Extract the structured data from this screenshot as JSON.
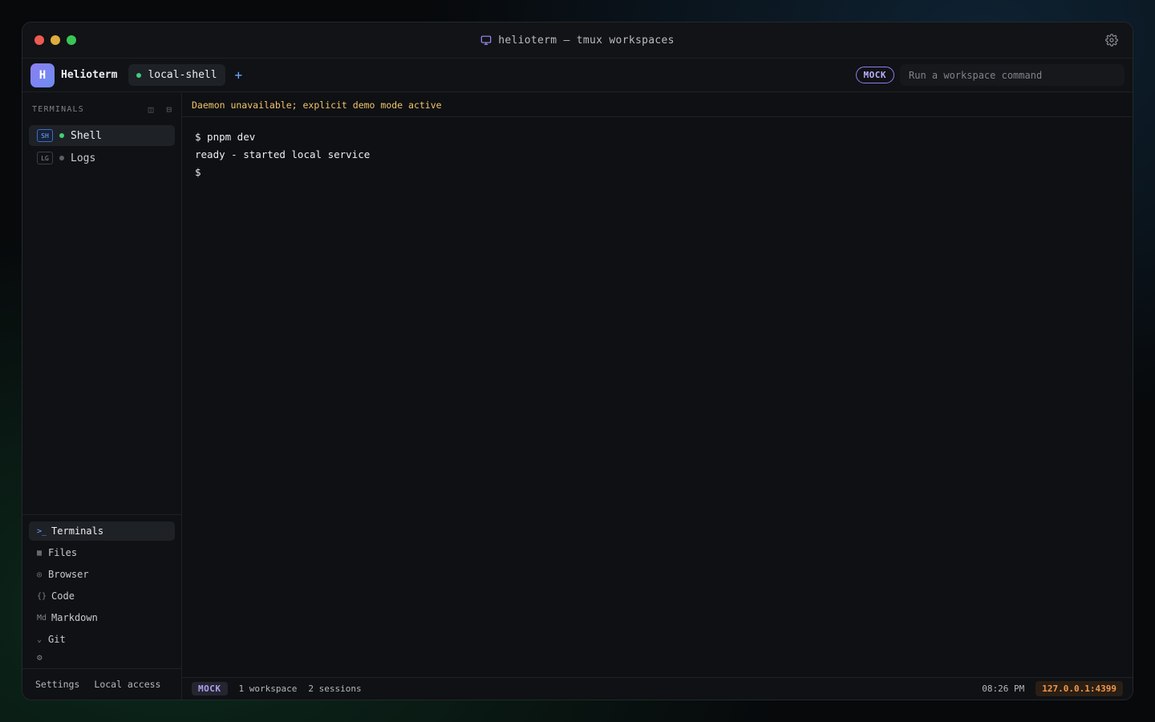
{
  "window": {
    "title": "helioterm — tmux workspaces"
  },
  "topbar": {
    "logo_letter": "H",
    "brand": "Helioterm",
    "workspace_tab": "local-shell",
    "add_tab": "+",
    "mode_badge": "MOCK",
    "command_placeholder": "Run a workspace command"
  },
  "sidebar": {
    "section_title": "TERMINALS",
    "terminals": [
      {
        "badge": "SH",
        "label": "Shell",
        "status": "running"
      },
      {
        "badge": "LG",
        "label": "Logs",
        "status": "idle"
      }
    ],
    "nav": [
      {
        "icon": ">_",
        "label": "Terminals"
      },
      {
        "icon": "▦",
        "label": "Files"
      },
      {
        "icon": "◎",
        "label": "Browser"
      },
      {
        "icon": "{}",
        "label": "Code"
      },
      {
        "icon": "Md",
        "label": "Markdown"
      },
      {
        "icon": "⌄",
        "label": "Git"
      }
    ],
    "nav_extra_icon": "⚙",
    "footer": {
      "settings": "Settings",
      "local_access": "Local access"
    }
  },
  "main": {
    "banner": "Daemon unavailable; explicit demo mode active",
    "terminal_lines": [
      "$ pnpm dev",
      "ready - started local service",
      "$"
    ]
  },
  "statusbar": {
    "mode": "MOCK",
    "workspaces": "1 workspace",
    "sessions": "2 sessions",
    "time": "08:26 PM",
    "host": "127.0.0.1:4399"
  },
  "colors": {
    "accent": "#8b7ef3",
    "running": "#3fcf7a",
    "warning": "#f2c56a",
    "host": "#f1964a"
  }
}
